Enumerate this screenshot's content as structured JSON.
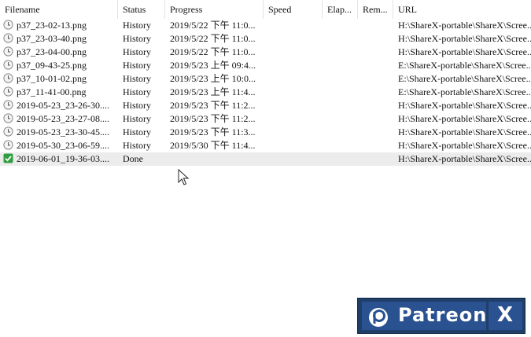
{
  "columns": {
    "filename": "Filename",
    "status": "Status",
    "progress": "Progress",
    "speed": "Speed",
    "elapsed": "Elap...",
    "remaining": "Rem...",
    "url": "URL"
  },
  "rows": [
    {
      "filename": "p37_23-02-13.png",
      "status": "History",
      "progress": "2019/5/22 下午 11:0...",
      "speed": "",
      "elapsed": "",
      "remaining": "",
      "url": "H:\\ShareX-portable\\ShareX\\Scree...",
      "icon": "history-icon"
    },
    {
      "filename": "p37_23-03-40.png",
      "status": "History",
      "progress": "2019/5/22 下午 11:0...",
      "speed": "",
      "elapsed": "",
      "remaining": "",
      "url": "H:\\ShareX-portable\\ShareX\\Scree...",
      "icon": "history-icon"
    },
    {
      "filename": "p37_23-04-00.png",
      "status": "History",
      "progress": "2019/5/22 下午 11:0...",
      "speed": "",
      "elapsed": "",
      "remaining": "",
      "url": "H:\\ShareX-portable\\ShareX\\Scree...",
      "icon": "history-icon"
    },
    {
      "filename": "p37_09-43-25.png",
      "status": "History",
      "progress": "2019/5/23 上午 09:4...",
      "speed": "",
      "elapsed": "",
      "remaining": "",
      "url": "E:\\ShareX-portable\\ShareX\\Scree...",
      "icon": "history-icon"
    },
    {
      "filename": "p37_10-01-02.png",
      "status": "History",
      "progress": "2019/5/23 上午 10:0...",
      "speed": "",
      "elapsed": "",
      "remaining": "",
      "url": "E:\\ShareX-portable\\ShareX\\Scree...",
      "icon": "history-icon"
    },
    {
      "filename": "p37_11-41-00.png",
      "status": "History",
      "progress": "2019/5/23 上午 11:4...",
      "speed": "",
      "elapsed": "",
      "remaining": "",
      "url": "E:\\ShareX-portable\\ShareX\\Scree...",
      "icon": "history-icon"
    },
    {
      "filename": "2019-05-23_23-26-30....",
      "status": "History",
      "progress": "2019/5/23 下午 11:2...",
      "speed": "",
      "elapsed": "",
      "remaining": "",
      "url": "H:\\ShareX-portable\\ShareX\\Scree...",
      "icon": "history-icon"
    },
    {
      "filename": "2019-05-23_23-27-08....",
      "status": "History",
      "progress": "2019/5/23 下午 11:2...",
      "speed": "",
      "elapsed": "",
      "remaining": "",
      "url": "H:\\ShareX-portable\\ShareX\\Scree...",
      "icon": "history-icon"
    },
    {
      "filename": "2019-05-23_23-30-45....",
      "status": "History",
      "progress": "2019/5/23 下午 11:3...",
      "speed": "",
      "elapsed": "",
      "remaining": "",
      "url": "H:\\ShareX-portable\\ShareX\\Scree...",
      "icon": "history-icon"
    },
    {
      "filename": "2019-05-30_23-06-59....",
      "status": "History",
      "progress": "2019/5/30 下午 11:4...",
      "speed": "",
      "elapsed": "",
      "remaining": "",
      "url": "H:\\ShareX-portable\\ShareX\\Scree...",
      "icon": "history-icon"
    },
    {
      "filename": "2019-06-01_19-36-03....",
      "status": "Done",
      "progress": "",
      "speed": "",
      "elapsed": "",
      "remaining": "",
      "url": "H:\\ShareX-portable\\ShareX\\Scree...",
      "icon": "done-check-icon",
      "selected": true
    }
  ],
  "banner": {
    "brand": "Patreon",
    "close": "X",
    "background": "#2a5290",
    "border": "#1f3e68"
  },
  "colors": {
    "selected_row": "#ececec",
    "history_icon_border": "#8a8a8a",
    "done_icon_green": "#2e9e3e"
  }
}
